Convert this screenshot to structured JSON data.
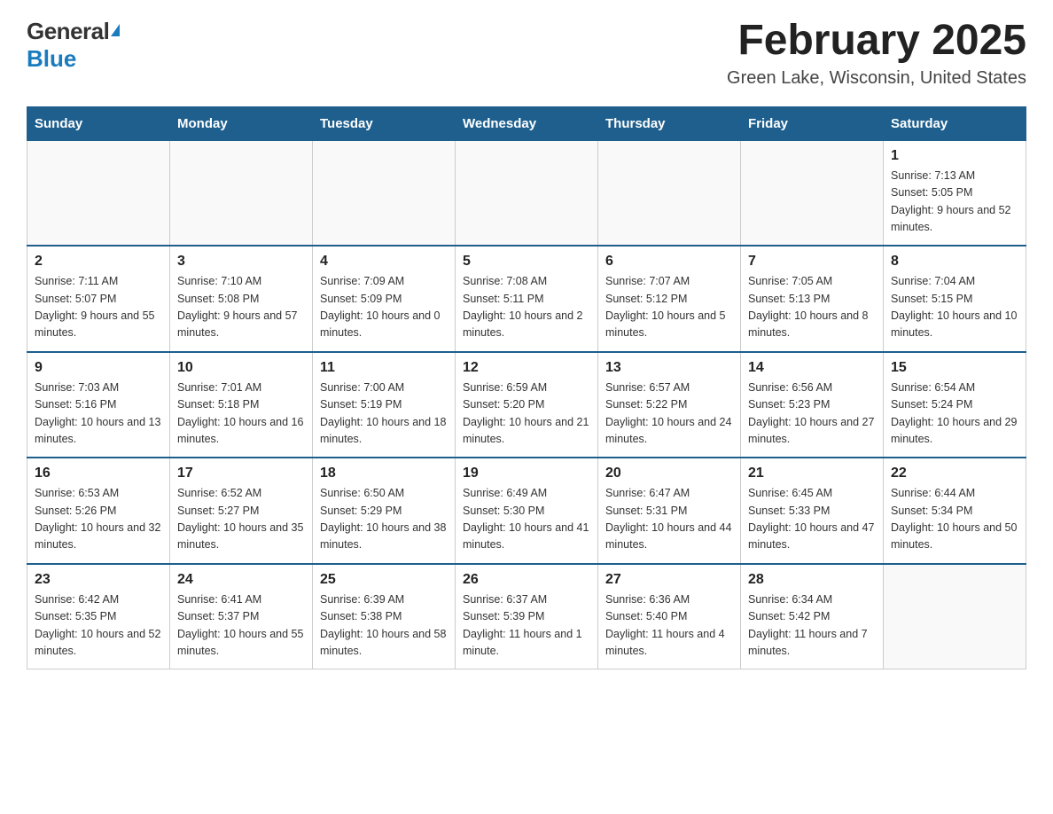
{
  "header": {
    "logo_general": "General",
    "logo_blue": "Blue",
    "month_title": "February 2025",
    "location": "Green Lake, Wisconsin, United States"
  },
  "days_of_week": [
    "Sunday",
    "Monday",
    "Tuesday",
    "Wednesday",
    "Thursday",
    "Friday",
    "Saturday"
  ],
  "weeks": [
    [
      {
        "day": "",
        "sunrise": "",
        "sunset": "",
        "daylight": ""
      },
      {
        "day": "",
        "sunrise": "",
        "sunset": "",
        "daylight": ""
      },
      {
        "day": "",
        "sunrise": "",
        "sunset": "",
        "daylight": ""
      },
      {
        "day": "",
        "sunrise": "",
        "sunset": "",
        "daylight": ""
      },
      {
        "day": "",
        "sunrise": "",
        "sunset": "",
        "daylight": ""
      },
      {
        "day": "",
        "sunrise": "",
        "sunset": "",
        "daylight": ""
      },
      {
        "day": "1",
        "sunrise": "Sunrise: 7:13 AM",
        "sunset": "Sunset: 5:05 PM",
        "daylight": "Daylight: 9 hours and 52 minutes."
      }
    ],
    [
      {
        "day": "2",
        "sunrise": "Sunrise: 7:11 AM",
        "sunset": "Sunset: 5:07 PM",
        "daylight": "Daylight: 9 hours and 55 minutes."
      },
      {
        "day": "3",
        "sunrise": "Sunrise: 7:10 AM",
        "sunset": "Sunset: 5:08 PM",
        "daylight": "Daylight: 9 hours and 57 minutes."
      },
      {
        "day": "4",
        "sunrise": "Sunrise: 7:09 AM",
        "sunset": "Sunset: 5:09 PM",
        "daylight": "Daylight: 10 hours and 0 minutes."
      },
      {
        "day": "5",
        "sunrise": "Sunrise: 7:08 AM",
        "sunset": "Sunset: 5:11 PM",
        "daylight": "Daylight: 10 hours and 2 minutes."
      },
      {
        "day": "6",
        "sunrise": "Sunrise: 7:07 AM",
        "sunset": "Sunset: 5:12 PM",
        "daylight": "Daylight: 10 hours and 5 minutes."
      },
      {
        "day": "7",
        "sunrise": "Sunrise: 7:05 AM",
        "sunset": "Sunset: 5:13 PM",
        "daylight": "Daylight: 10 hours and 8 minutes."
      },
      {
        "day": "8",
        "sunrise": "Sunrise: 7:04 AM",
        "sunset": "Sunset: 5:15 PM",
        "daylight": "Daylight: 10 hours and 10 minutes."
      }
    ],
    [
      {
        "day": "9",
        "sunrise": "Sunrise: 7:03 AM",
        "sunset": "Sunset: 5:16 PM",
        "daylight": "Daylight: 10 hours and 13 minutes."
      },
      {
        "day": "10",
        "sunrise": "Sunrise: 7:01 AM",
        "sunset": "Sunset: 5:18 PM",
        "daylight": "Daylight: 10 hours and 16 minutes."
      },
      {
        "day": "11",
        "sunrise": "Sunrise: 7:00 AM",
        "sunset": "Sunset: 5:19 PM",
        "daylight": "Daylight: 10 hours and 18 minutes."
      },
      {
        "day": "12",
        "sunrise": "Sunrise: 6:59 AM",
        "sunset": "Sunset: 5:20 PM",
        "daylight": "Daylight: 10 hours and 21 minutes."
      },
      {
        "day": "13",
        "sunrise": "Sunrise: 6:57 AM",
        "sunset": "Sunset: 5:22 PM",
        "daylight": "Daylight: 10 hours and 24 minutes."
      },
      {
        "day": "14",
        "sunrise": "Sunrise: 6:56 AM",
        "sunset": "Sunset: 5:23 PM",
        "daylight": "Daylight: 10 hours and 27 minutes."
      },
      {
        "day": "15",
        "sunrise": "Sunrise: 6:54 AM",
        "sunset": "Sunset: 5:24 PM",
        "daylight": "Daylight: 10 hours and 29 minutes."
      }
    ],
    [
      {
        "day": "16",
        "sunrise": "Sunrise: 6:53 AM",
        "sunset": "Sunset: 5:26 PM",
        "daylight": "Daylight: 10 hours and 32 minutes."
      },
      {
        "day": "17",
        "sunrise": "Sunrise: 6:52 AM",
        "sunset": "Sunset: 5:27 PM",
        "daylight": "Daylight: 10 hours and 35 minutes."
      },
      {
        "day": "18",
        "sunrise": "Sunrise: 6:50 AM",
        "sunset": "Sunset: 5:29 PM",
        "daylight": "Daylight: 10 hours and 38 minutes."
      },
      {
        "day": "19",
        "sunrise": "Sunrise: 6:49 AM",
        "sunset": "Sunset: 5:30 PM",
        "daylight": "Daylight: 10 hours and 41 minutes."
      },
      {
        "day": "20",
        "sunrise": "Sunrise: 6:47 AM",
        "sunset": "Sunset: 5:31 PM",
        "daylight": "Daylight: 10 hours and 44 minutes."
      },
      {
        "day": "21",
        "sunrise": "Sunrise: 6:45 AM",
        "sunset": "Sunset: 5:33 PM",
        "daylight": "Daylight: 10 hours and 47 minutes."
      },
      {
        "day": "22",
        "sunrise": "Sunrise: 6:44 AM",
        "sunset": "Sunset: 5:34 PM",
        "daylight": "Daylight: 10 hours and 50 minutes."
      }
    ],
    [
      {
        "day": "23",
        "sunrise": "Sunrise: 6:42 AM",
        "sunset": "Sunset: 5:35 PM",
        "daylight": "Daylight: 10 hours and 52 minutes."
      },
      {
        "day": "24",
        "sunrise": "Sunrise: 6:41 AM",
        "sunset": "Sunset: 5:37 PM",
        "daylight": "Daylight: 10 hours and 55 minutes."
      },
      {
        "day": "25",
        "sunrise": "Sunrise: 6:39 AM",
        "sunset": "Sunset: 5:38 PM",
        "daylight": "Daylight: 10 hours and 58 minutes."
      },
      {
        "day": "26",
        "sunrise": "Sunrise: 6:37 AM",
        "sunset": "Sunset: 5:39 PM",
        "daylight": "Daylight: 11 hours and 1 minute."
      },
      {
        "day": "27",
        "sunrise": "Sunrise: 6:36 AM",
        "sunset": "Sunset: 5:40 PM",
        "daylight": "Daylight: 11 hours and 4 minutes."
      },
      {
        "day": "28",
        "sunrise": "Sunrise: 6:34 AM",
        "sunset": "Sunset: 5:42 PM",
        "daylight": "Daylight: 11 hours and 7 minutes."
      },
      {
        "day": "",
        "sunrise": "",
        "sunset": "",
        "daylight": ""
      }
    ]
  ]
}
